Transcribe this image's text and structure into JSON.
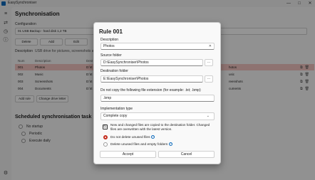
{
  "window": {
    "title": "EasySynchroniser",
    "controls": [
      "—",
      "□",
      "✕"
    ]
  },
  "leftbar": {
    "icons": [
      "menu-icon",
      "sync-icon",
      "history-icon",
      "info-icon",
      "settings-icon"
    ]
  },
  "main": {
    "title": "Synchronisation",
    "configuration_label": "Configuration",
    "configuration_value": "01 USB Backup - hard disk 1,2 TB",
    "buttons": {
      "delete": "Delete",
      "add": "Add",
      "edit": "Edit"
    },
    "description_label": "Description",
    "description_value": "USB drive for pictures, screenshots and m",
    "columns": [
      "Num",
      "Description",
      "Dest"
    ],
    "rows": [
      {
        "num": "001",
        "desc": "Photos",
        "src": "D:\\E",
        "right": "hotos"
      },
      {
        "num": "002",
        "desc": "Music",
        "src": "D:\\E",
        "right": "usic"
      },
      {
        "num": "003",
        "desc": "Screenshots",
        "src": "D:\\E",
        "right": "reenshots"
      },
      {
        "num": "004",
        "desc": "Documents",
        "src": "D:\\E",
        "right": "cuments"
      }
    ],
    "add_rule": "Add rule",
    "change_drive": "Change drive letter",
    "scheduled_title": "Scheduled synchronisation task",
    "schedule_options": [
      "No startup",
      "Periodic",
      "Execute daily"
    ]
  },
  "dialog": {
    "title": "Rule 001",
    "description_label": "Description",
    "description_value": "Photos",
    "source_label": "Source folder",
    "source_value": "D:\\EasySynchroniser\\Photos",
    "dest_label": "Destination folder",
    "dest_value": "E:\\EasySynchroniser\\Photos",
    "exclude_label": "Do not copy the following file extension (for example: .txt; .bmp)",
    "exclude_value": ".bmp",
    "impl_label": "Implementation type",
    "impl_value": "Complete copy",
    "info": "New and changed files are copied to the destination folder. Changed files are overwritten with the latest version.",
    "opt1": "Do not delete unused files",
    "opt2": "Delete unused files and empty folders",
    "accept": "Accept",
    "cancel": "Cancel",
    "browse": "..."
  }
}
